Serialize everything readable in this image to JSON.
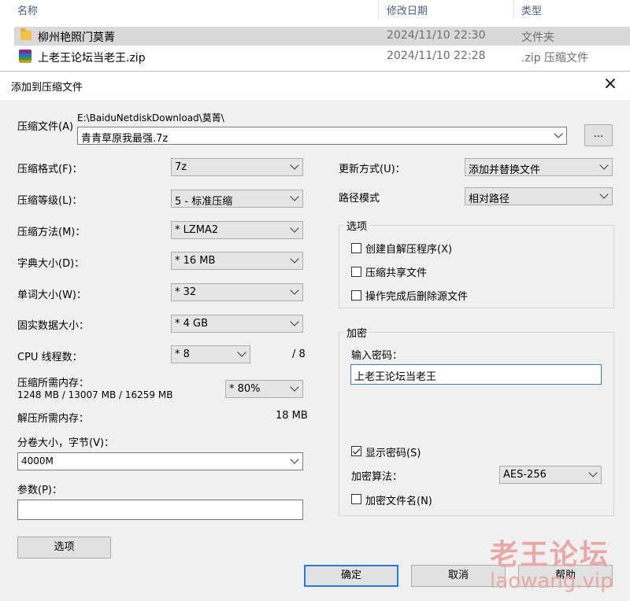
{
  "explorer": {
    "columns": {
      "name": "名称",
      "date": "修改日期",
      "type": "类型"
    },
    "rows": [
      {
        "name": "柳州艳照门莫菁",
        "date": "2024/11/10 22:30",
        "type": "文件夹",
        "icon": "folder-icon"
      },
      {
        "name": "上老王论坛当老王.zip",
        "date": "2024/11/10 22:28",
        "type": ".zip 压缩文件",
        "icon": "winrar-archive-icon"
      }
    ]
  },
  "dialog": {
    "title": "添加到压缩文件",
    "archive_label": "压缩文件(A)",
    "archive_path": "E:\\BaiduNetdiskDownload\\莫菁\\",
    "archive_name": "青青草原我最强.7z",
    "browse_label": "...",
    "format_label": "压缩格式(F)：",
    "format_value": "7z",
    "level_label": "压缩等级(L)：",
    "level_value": "5 - 标准压缩",
    "method_label": "压缩方法(M)：",
    "method_value": "* LZMA2",
    "dict_label": "字典大小(D)：",
    "dict_value": "* 16 MB",
    "word_label": "单词大小(W)：",
    "word_value": "* 32",
    "solid_label": "固实数据大小：",
    "solid_value": "* 4 GB",
    "threads_label": "CPU 线程数：",
    "threads_value": "* 8",
    "threads_total": "/ 8",
    "mem_label": "压缩所需内存：",
    "mem_detail": "1248 MB / 13007 MB / 16259 MB",
    "mem_value": "* 80%",
    "decomp_label": "解压所需内存：",
    "decomp_value": "18 MB",
    "volume_label": "分卷大小，字节(V)：",
    "volume_value": "4000M",
    "params_label": "参数(P)：",
    "params_value": "",
    "options_button": "选项",
    "update_label": "更新方式(U)：",
    "update_value": "添加并替换文件",
    "path_label": "路径模式",
    "path_value": "相对路径",
    "options_group": "选项",
    "opt_sfx": "创建自解压程序(X)",
    "opt_shared": "压缩共享文件",
    "opt_delete": "操作完成后删除源文件",
    "encrypt_group": "加密",
    "password_label": "输入密码：",
    "password_value": "上老王论坛当老王",
    "show_password": "显示密码(S)",
    "show_password_checked": true,
    "enc_method_label": "加密算法：",
    "enc_method_value": "AES-256",
    "encrypt_names": "加密文件名(N)",
    "ok": "确定",
    "cancel": "取消",
    "help": "帮助"
  },
  "watermark": {
    "title": "老王论坛",
    "url": "laowang.vip"
  }
}
